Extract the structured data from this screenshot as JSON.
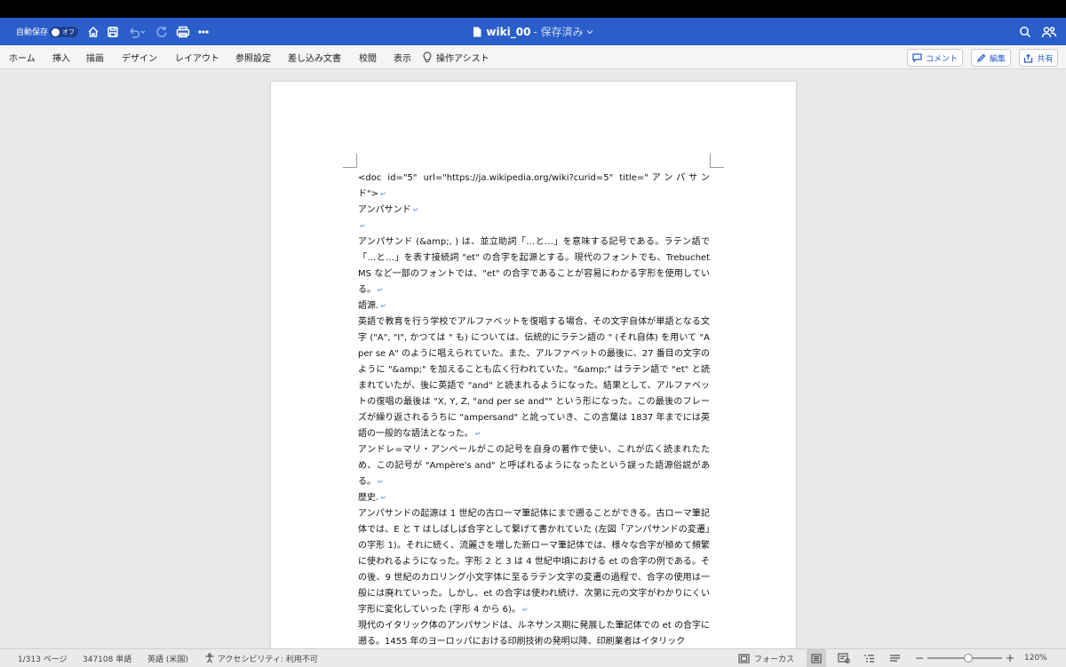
{
  "title_bar": {
    "autosave_label": "自動保存",
    "autosave_state": "オフ",
    "doc_name": "wiki_00",
    "doc_state": "- 保存済み"
  },
  "ribbon": {
    "tabs": [
      "ホーム",
      "挿入",
      "描画",
      "デザイン",
      "レイアウト",
      "参照設定",
      "差し込み文書",
      "校閲",
      "表示"
    ],
    "assist": "操作アシスト",
    "comment_btn": "コメント",
    "edit_btn": "編集",
    "share_btn": "共有"
  },
  "document": {
    "paragraphs": [
      "<doc id=\"5\" url=\"https://ja.wikipedia.org/wiki?curid=5\" title=\"アンパサンド\">",
      "アンパサンド",
      "",
      "アンパサンド (&amp;, ) は、並立助詞「…と…」を意味する記号である。ラテン語で「…と…」を表す接続詞 \"et\" の合字を起源とする。現代のフォントでも、Trebuchet MS など一部のフォントでは、\"et\" の合字であることが容易にわかる字形を使用している。",
      "語源.",
      "英語で教育を行う学校でアルファベットを復唱する場合、その文字自体が単語となる文字 (\"A\", \"I\", かつては \" も) については、伝統的にラテン語の \" (それ自体) を用いて \"A per se A\" のように唱えられていた。また、アルファベットの最後に、27 番目の文字のように \"&amp;\" を加えることも広く行われていた。\"&amp;\" はラテン語で \"et\" と読まれていたが、後に英語で \"and\" と読まれるようになった。結果として、アルファベットの復唱の最後は \"X, Y, Z, \"and per se and\"\" という形になった。この最後のフレーズが繰り返されるうちに \"ampersand\" と訛っていき、この言葉は 1837 年までには英語の一般的な語法となった。",
      "アンドレ=マリ・アンペールがこの記号を自身の著作で使い、これが広く読まれたため、この記号が \"Ampère's and\" と呼ばれるようになったという誤った語源俗説がある。",
      "歴史.",
      "アンパサンドの起源は 1 世紀の古ローマ筆記体にまで遡ることができる。古ローマ筆記体では、E と T はしばしば合字として繋げて書かれていた (左図「アンパサンドの変遷」の字形 1)。それに続く、流麗さを増した新ローマ筆記体では、様々な合字が極めて頻繁に使われるようになった。字形 2 と 3 は 4 世紀中頃における et の合字の例である。その後、9 世紀のカロリング小文字体に至るラテン文字の変遷の過程で、合字の使用は一般には廃れていった。しかし、et の合字は使われ続け、次第に元の文字がわかりにくい字形に変化していった (字形 4 から 6)。",
      "現代のイタリック体のアンパサンドは、ルネサンス期に発展した筆記体での et の合字に遡る。1455 年のヨーロッパにおける印刷技術の発明以降、印刷業者はイタリック"
    ],
    "paragraph_mark": "↵"
  },
  "status_bar": {
    "page": "1/313 ページ",
    "words": "347108 単語",
    "language": "英語 (米国)",
    "accessibility": "アクセシビリティ: 利用不可",
    "focus": "フォーカス",
    "zoom_minus": "−",
    "zoom_plus": "+",
    "zoom": "120%",
    "zoom_level_fraction": 0.55
  },
  "colors": {
    "title_bar": "#2b5ec9",
    "ribbon": "#f5f5f5",
    "canvas": "#e9e9e9",
    "page": "#ffffff"
  }
}
